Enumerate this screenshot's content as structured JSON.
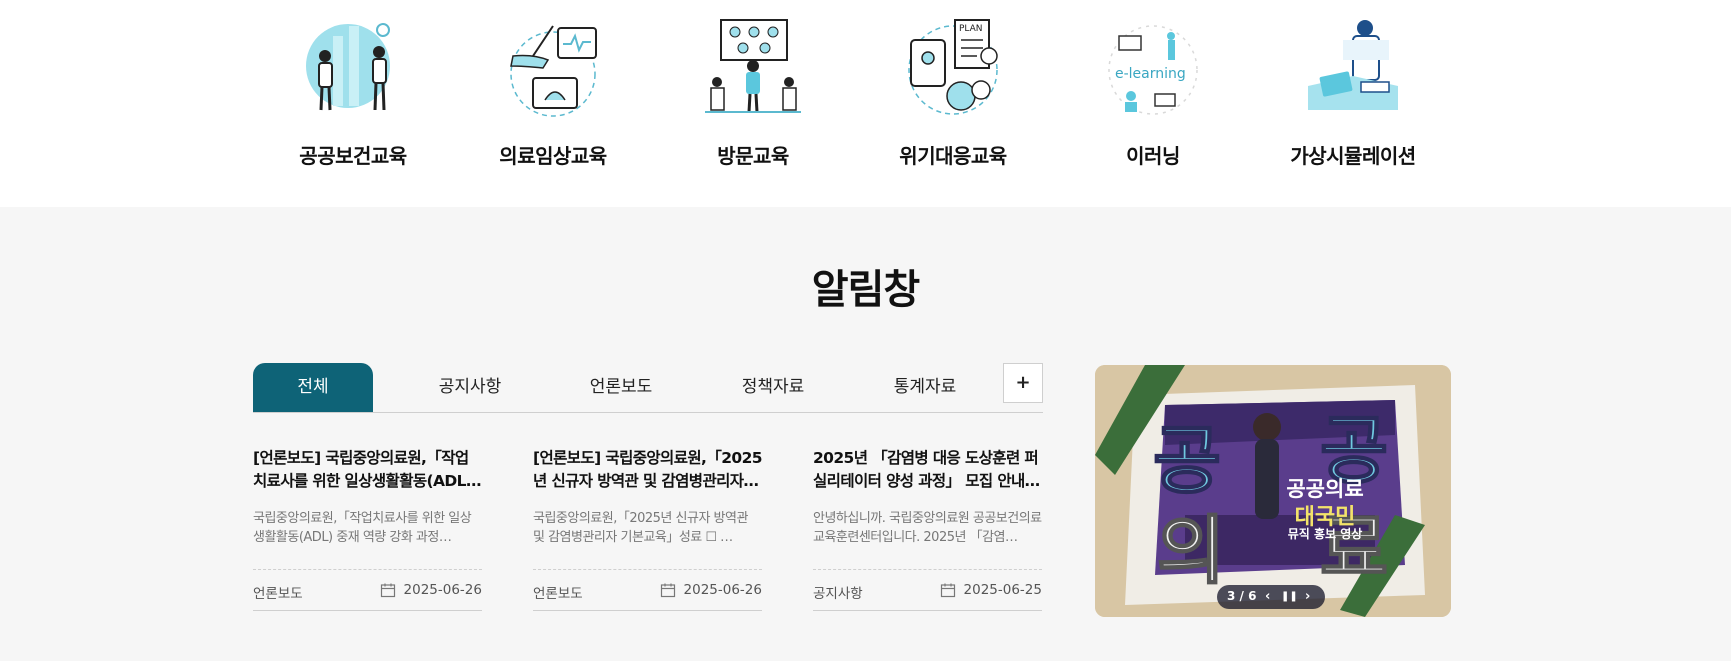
{
  "categories": [
    {
      "label": "공공보건교육",
      "icon": "public-health-education-icon"
    },
    {
      "label": "의료임상교육",
      "icon": "clinical-education-icon"
    },
    {
      "label": "방문교육",
      "icon": "visiting-education-icon"
    },
    {
      "label": "위기대응교육",
      "icon": "crisis-response-education-icon"
    },
    {
      "label": "이러닝",
      "icon": "e-learning-icon",
      "illustration_text": "e-learning"
    },
    {
      "label": "가상시뮬레이션",
      "icon": "virtual-simulation-icon"
    }
  ],
  "board": {
    "title": "알림창",
    "tabs": [
      {
        "label": "전체",
        "active": true
      },
      {
        "label": "공지사항",
        "active": false
      },
      {
        "label": "언론보도",
        "active": false
      },
      {
        "label": "정책자료",
        "active": false
      },
      {
        "label": "통계자료",
        "active": false
      }
    ],
    "more_label": "+",
    "cards": [
      {
        "title": "[언론보도] 국립중앙의료원,「작업치료사를 위한 일상생활활동(ADL) …",
        "body": "  국립중앙의료원,「작업치료사를 위한 일상생활활동(ADL) 중재 역량 강화 과정…",
        "category": "언론보도",
        "date": "2025-06-26"
      },
      {
        "title": "[언론보도] 국립중앙의료원,「2025년 신규자 방역관 및 감염병관리자…",
        "body": "  국립중앙의료원,「2025년 신규자 방역관 및 감염병관리자 기본교육」성료   ☐ …",
        "category": "언론보도",
        "date": "2025-06-26"
      },
      {
        "title": "2025년 「감염병 대응 도상훈련 퍼실리테이터 양성 과정」 모집 안내…",
        "body": "안녕하십니까. 국립중앙의료원 공공보건의료교육훈련센터입니다. 2025년 「감염…",
        "category": "공지사항",
        "date": "2025-06-25"
      }
    ]
  },
  "banner": {
    "big_chars": [
      "공",
      "공",
      "의",
      "료"
    ],
    "line1": "공공의료",
    "line2": "대국민",
    "line3": "뮤직 홍보 영상",
    "counter": "3 / 6",
    "prev_glyph": "‹",
    "pause_glyph": "❚❚",
    "next_glyph": "›"
  },
  "colors": {
    "accent": "#0e6377",
    "section_bg": "#f6f6f6",
    "illustration_blue": "#8fdbe8",
    "banner_purple": "#5a3d8c"
  }
}
